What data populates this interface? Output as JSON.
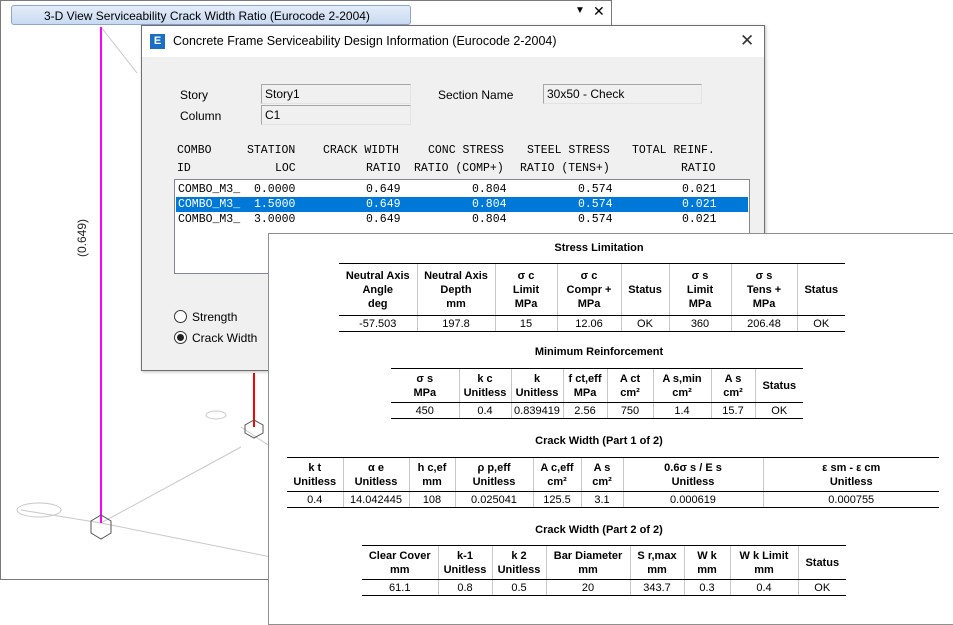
{
  "view3d": {
    "title": "3-D View  Serviceability Crack Width Ratio  (Eurocode 2-2004)",
    "menu_glyph": "▼",
    "close_glyph": "✕",
    "ratio_label": "(0.649)",
    "colors": {
      "column": "#ff00ff",
      "beam": "#ff0000",
      "grid": "#bbbbbb"
    }
  },
  "dialog": {
    "title": "Concrete Frame Serviceability Design Information (Eurocode 2-2004)",
    "app_icon_letter": "E",
    "close_glyph": "✕",
    "story_label": "Story",
    "story_value": "Story1",
    "column_label": "Column",
    "column_value": "C1",
    "section_label": "Section Name",
    "section_value": "30x50 - Check",
    "headers_line1": [
      "COMBO",
      "STATION",
      "CRACK WIDTH",
      "CONC STRESS",
      "STEEL STRESS",
      "TOTAL REINF."
    ],
    "headers_line2": [
      "ID",
      "LOC",
      "RATIO",
      "RATIO (COMP+)",
      "RATIO (TENS+)",
      "RATIO"
    ],
    "rows": [
      {
        "combo": "COMBO_M3_",
        "loc": "0.0000",
        "crack": "0.649",
        "conc": "0.804",
        "steel": "0.574",
        "reinf": "0.021"
      },
      {
        "combo": "COMBO_M3_",
        "loc": "1.5000",
        "crack": "0.649",
        "conc": "0.804",
        "steel": "0.574",
        "reinf": "0.021"
      },
      {
        "combo": "COMBO_M3_",
        "loc": "3.0000",
        "crack": "0.649",
        "conc": "0.804",
        "steel": "0.574",
        "reinf": "0.021"
      }
    ],
    "selected_row": 1,
    "radio_strength": "Strength",
    "radio_crack": "Crack Width"
  },
  "report": {
    "stress": {
      "title": "Stress Limitation",
      "headers": [
        [
          "Neutral Axis",
          "Angle",
          "deg"
        ],
        [
          "Neutral Axis",
          "Depth",
          "mm"
        ],
        [
          "σ c",
          "Limit",
          "MPa"
        ],
        [
          "σ c",
          "Compr +",
          "MPa"
        ],
        [
          "Status"
        ],
        [
          "σ s",
          "Limit",
          "MPa"
        ],
        [
          "σ s",
          "Tens +",
          "MPa"
        ],
        [
          "Status"
        ]
      ],
      "values": [
        "-57.503",
        "197.8",
        "15",
        "12.06",
        "OK",
        "360",
        "206.48",
        "OK"
      ]
    },
    "minreinf": {
      "title": "Minimum Reinforcement",
      "headers": [
        [
          "σ s",
          "MPa"
        ],
        [
          "k c",
          "Unitless"
        ],
        [
          "k",
          "Unitless"
        ],
        [
          "f ct,eff",
          "MPa"
        ],
        [
          "A ct",
          "cm²"
        ],
        [
          "A s,min",
          "cm²"
        ],
        [
          "A s",
          "cm²"
        ],
        [
          "Status"
        ]
      ],
      "values": [
        "450",
        "0.4",
        "0.839419",
        "2.56",
        "750",
        "1.4",
        "15.7",
        "OK"
      ]
    },
    "crack1": {
      "title": "Crack Width (Part 1 of 2)",
      "headers": [
        [
          "k t",
          "Unitless"
        ],
        [
          "α e",
          "Unitless"
        ],
        [
          "h c,ef",
          "mm"
        ],
        [
          "ρ p,eff",
          "Unitless"
        ],
        [
          "A c,eff",
          "cm²"
        ],
        [
          "A s",
          "cm²"
        ],
        [
          "0.6σ s / E s",
          "Unitless"
        ],
        [
          "ε sm - ε cm",
          "Unitless"
        ]
      ],
      "values": [
        "0.4",
        "14.042445",
        "108",
        "0.025041",
        "125.5",
        "3.1",
        "0.000619",
        "0.000755"
      ]
    },
    "crack2": {
      "title": "Crack Width (Part 2 of 2)",
      "headers": [
        [
          "Clear Cover",
          "mm"
        ],
        [
          "k-1",
          "Unitless"
        ],
        [
          "k 2",
          "Unitless"
        ],
        [
          "Bar Diameter",
          "mm"
        ],
        [
          "S r,max",
          "mm"
        ],
        [
          "W k",
          "mm"
        ],
        [
          "W k Limit",
          "mm"
        ],
        [
          "Status"
        ]
      ],
      "values": [
        "61.1",
        "0.8",
        "0.5",
        "20",
        "343.7",
        "0.3",
        "0.4",
        "OK"
      ]
    }
  }
}
